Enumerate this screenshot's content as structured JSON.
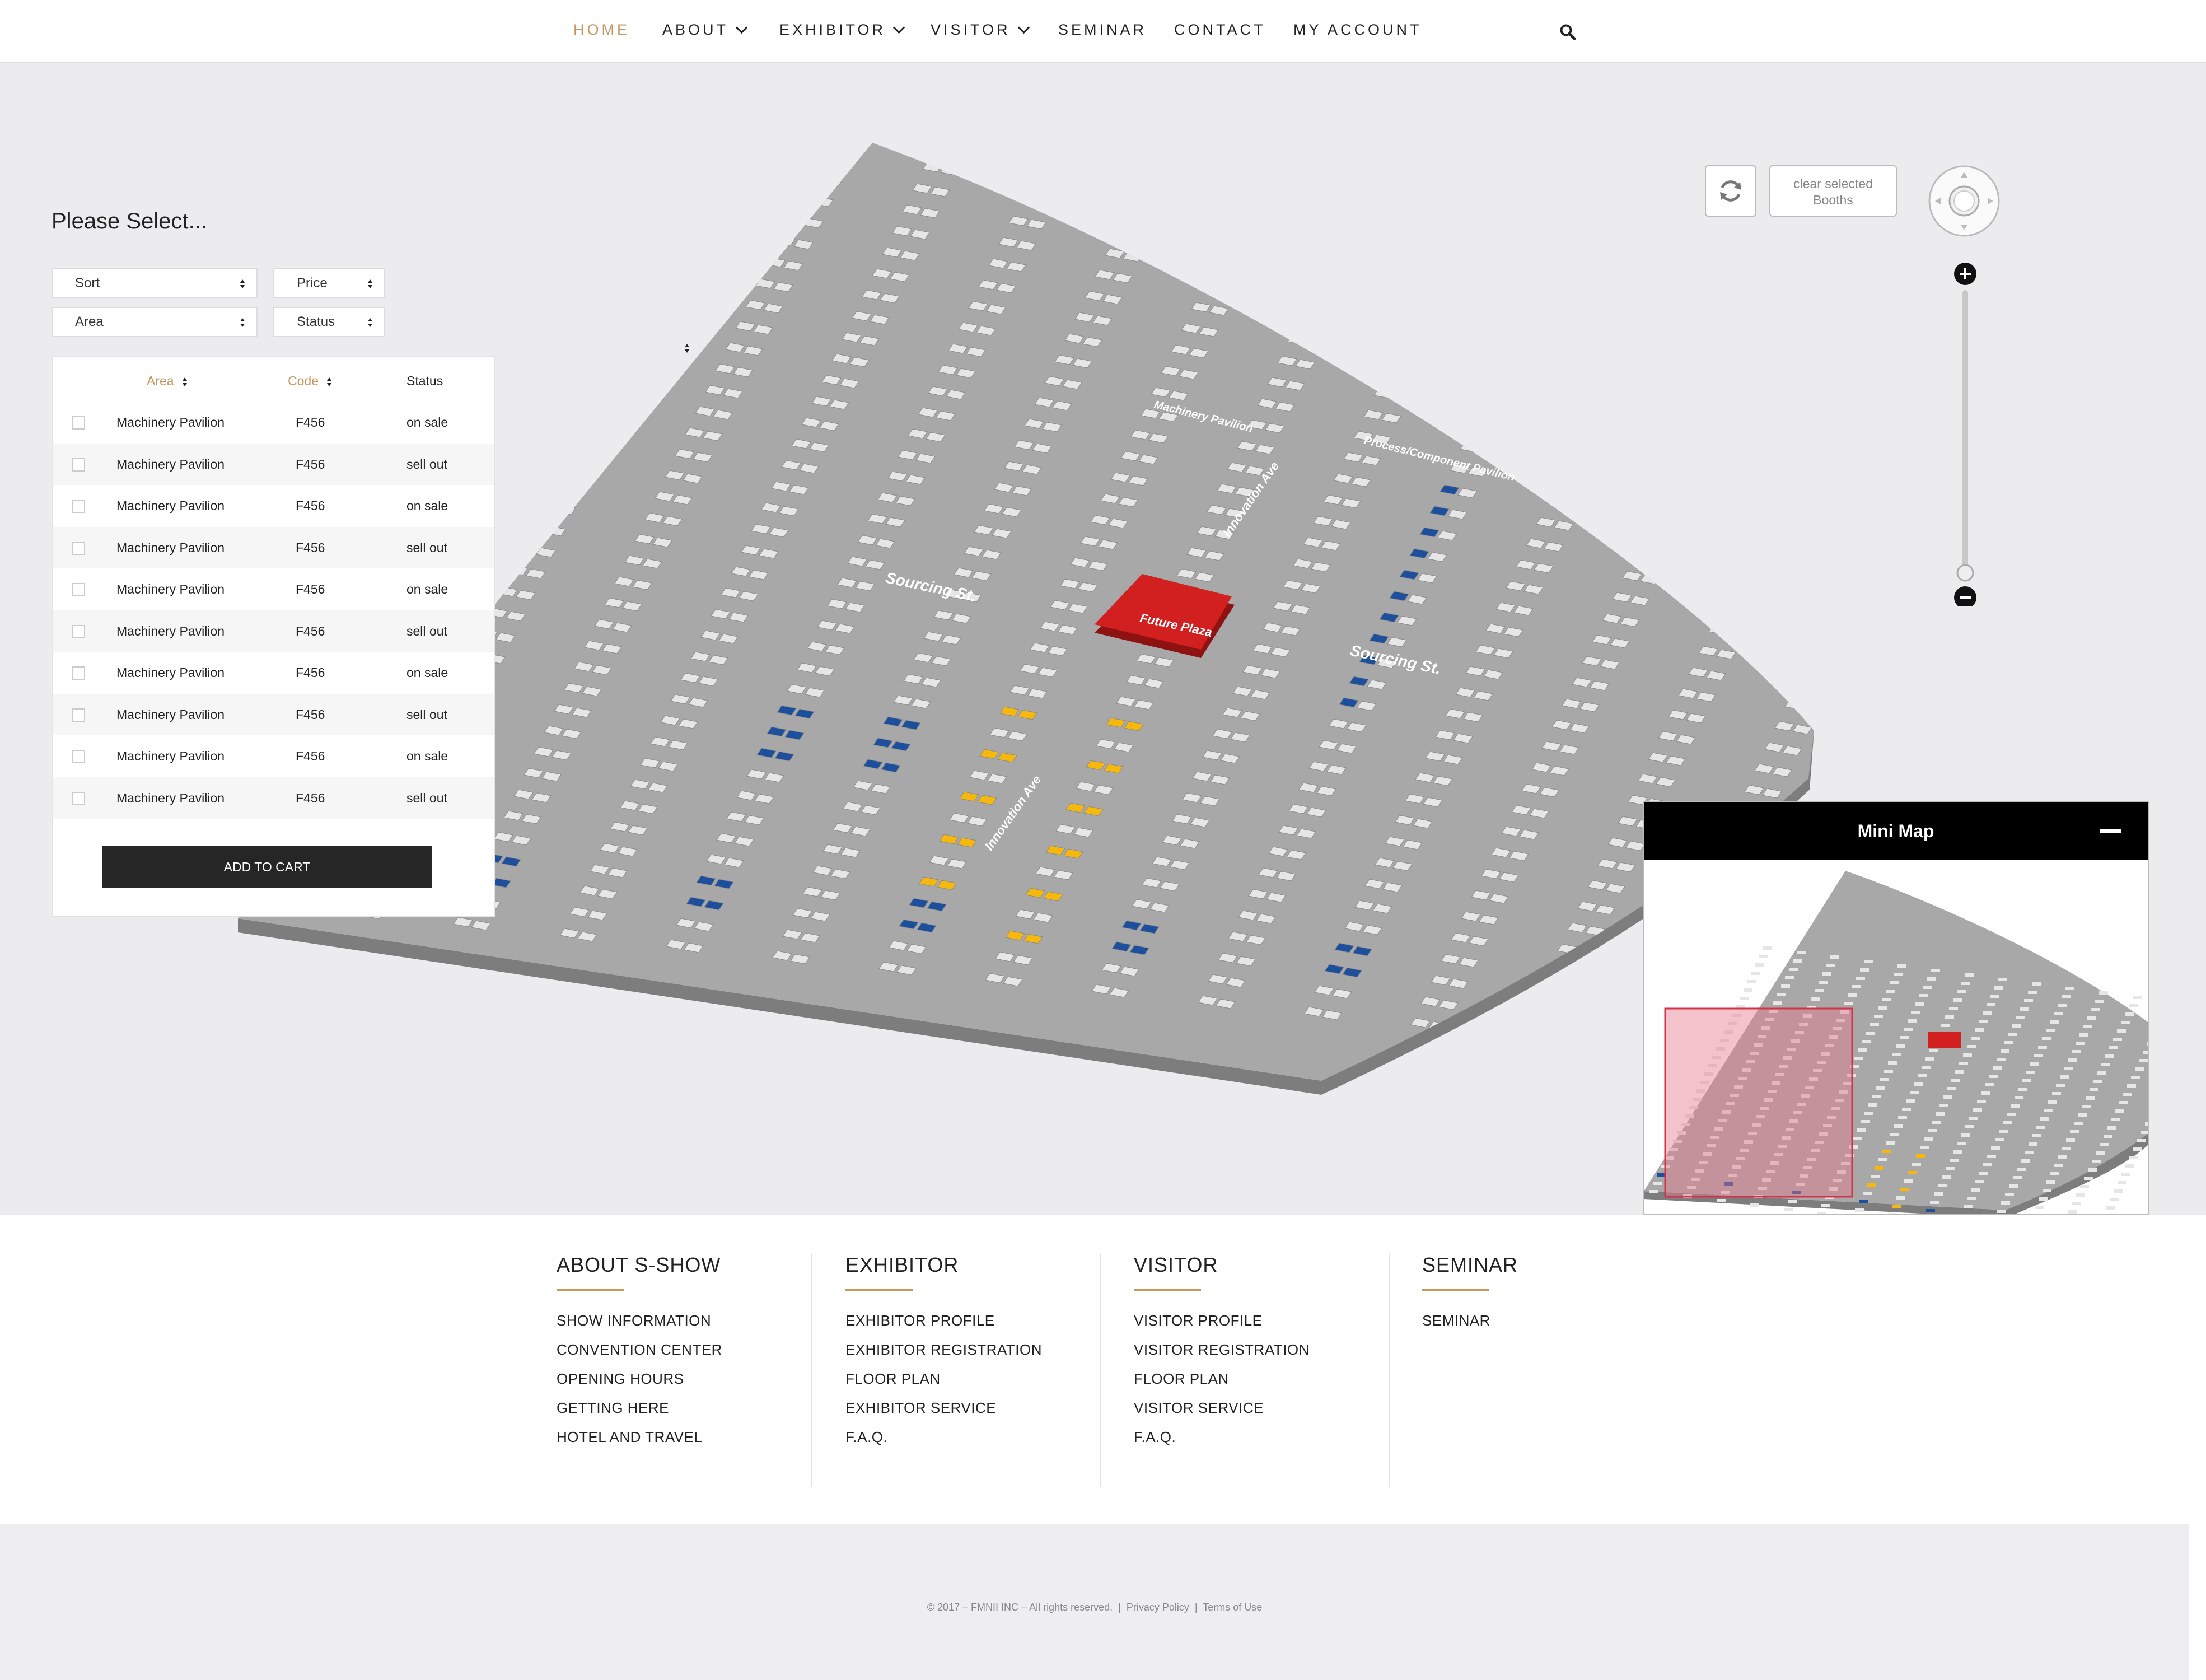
{
  "nav": {
    "home": "HOME",
    "about": "ABOUT",
    "exhibitor": "EXHIBITOR",
    "visitor": "VISITOR",
    "seminar": "SEMINAR",
    "contact": "CONTACT",
    "account": "MY ACCOUNT",
    "active_color": "#c8955a"
  },
  "filter": {
    "heading": "Please Select...",
    "sort": "Sort",
    "price": "Price",
    "area": "Area",
    "status": "Status"
  },
  "table": {
    "headers": {
      "area": "Area",
      "code": "Code",
      "status": "Status"
    },
    "rows": [
      {
        "area": "Machinery Pavilion",
        "code": "F456",
        "status": "on sale"
      },
      {
        "area": "Machinery Pavilion",
        "code": "F456",
        "status": "sell out"
      },
      {
        "area": "Machinery Pavilion",
        "code": "F456",
        "status": "on sale"
      },
      {
        "area": "Machinery Pavilion",
        "code": "F456",
        "status": "sell out"
      },
      {
        "area": "Machinery Pavilion",
        "code": "F456",
        "status": "on sale"
      },
      {
        "area": "Machinery Pavilion",
        "code": "F456",
        "status": "sell out"
      },
      {
        "area": "Machinery Pavilion",
        "code": "F456",
        "status": "on sale"
      },
      {
        "area": "Machinery Pavilion",
        "code": "F456",
        "status": "sell out"
      },
      {
        "area": "Machinery Pavilion",
        "code": "F456",
        "status": "on sale"
      },
      {
        "area": "Machinery Pavilion",
        "code": "F456",
        "status": "sell out"
      }
    ],
    "add_to_cart": "ADD TO CART"
  },
  "map": {
    "labels": {
      "machinery": "Machinery Pavilion",
      "process": "Process/Component Pavilion",
      "sourcing1": "Sourcing St.",
      "sourcing2": "Sourcing St.",
      "innovation1": "Innovation Ave",
      "innovation2": "Innovation Ave",
      "plaza": "Future Plaza"
    },
    "clear_line1": "clear selected",
    "clear_line2": "Booths",
    "colors": {
      "floor": "#a8a8a8",
      "booth": "#e6e6e6",
      "sold": "#1d4f9c",
      "featured": "#f6b80c",
      "plaza": "#d21f1f"
    }
  },
  "minimap": {
    "title": "Mini Map"
  },
  "footer": {
    "about": {
      "title": "ABOUT S-SHOW",
      "links": [
        "SHOW INFORMATION",
        "CONVENTION CENTER",
        "OPENING HOURS",
        "GETTING HERE",
        "HOTEL AND TRAVEL"
      ]
    },
    "exhibitor": {
      "title": "EXHIBITOR",
      "links": [
        "EXHIBITOR PROFILE",
        "EXHIBITOR REGISTRATION",
        "FLOOR PLAN",
        "EXHIBITOR SERVICE",
        "F.A.Q."
      ]
    },
    "visitor": {
      "title": "VISITOR",
      "links": [
        "VISITOR PROFILE",
        "VISITOR REGISTRATION",
        "FLOOR PLAN",
        "VISITOR SERVICE",
        "F.A.Q."
      ]
    },
    "seminar": {
      "title": "SEMINAR",
      "links": [
        "SEMINAR"
      ]
    },
    "copyright": "© 2017 – FMNII INC – All rights reserved.",
    "privacy": "Privacy Policy",
    "terms": "Terms of Use"
  }
}
